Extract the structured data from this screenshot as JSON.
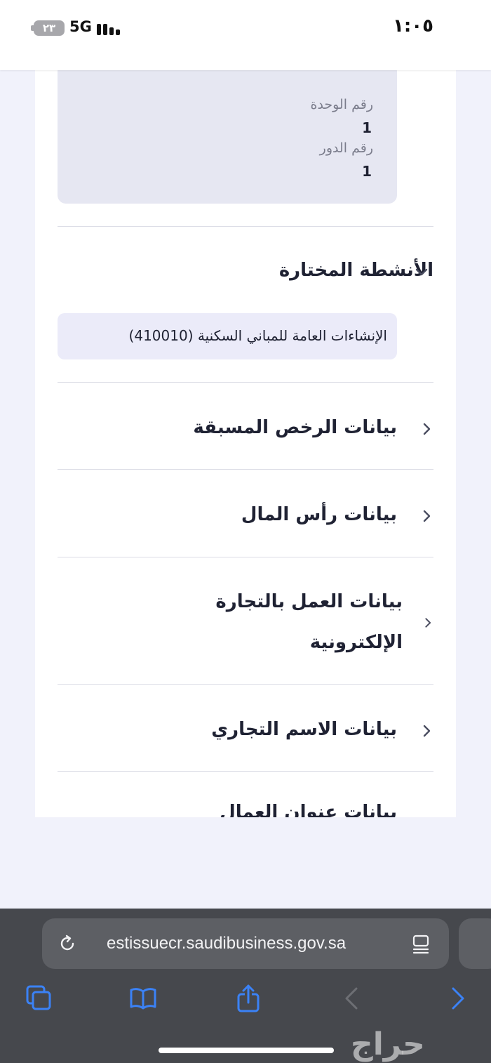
{
  "status_bar": {
    "time": "١:٠٥",
    "battery": "٢٣",
    "network": "5G"
  },
  "unit_info": {
    "unit_number_label": "رقم الوحدة",
    "unit_number_value": "1",
    "floor_number_label": "رقم الدور",
    "floor_number_value": "1"
  },
  "activities": {
    "title": "الأنشطة المختارة",
    "items": [
      "الإنشاءات العامة للمباني السكنية (410010)"
    ]
  },
  "sections": [
    {
      "label": "بيانات الرخص المسبقة"
    },
    {
      "label": "بيانات رأس المال"
    },
    {
      "label_line1": "بيانات العمل بالتجارة",
      "label_line2": "الإلكترونية"
    },
    {
      "label": "بيانات الاسم التجاري"
    },
    {
      "label": "بيانات عنوان العمال"
    }
  ],
  "browser": {
    "url": "estissuecr.saudibusiness.gov.sa"
  },
  "watermark": "حراج",
  "colors": {
    "accent": "#3b82f6",
    "chip_bg": "#ebebf9",
    "box_bg": "#e6e7f2",
    "page_bg": "#f1f2fb"
  },
  "icons": [
    "reload-icon",
    "reader-icon",
    "tabs-icon",
    "bookmarks-icon",
    "share-icon",
    "back-icon",
    "forward-icon",
    "chevron-down-icon",
    "chevron-left-icon"
  ]
}
